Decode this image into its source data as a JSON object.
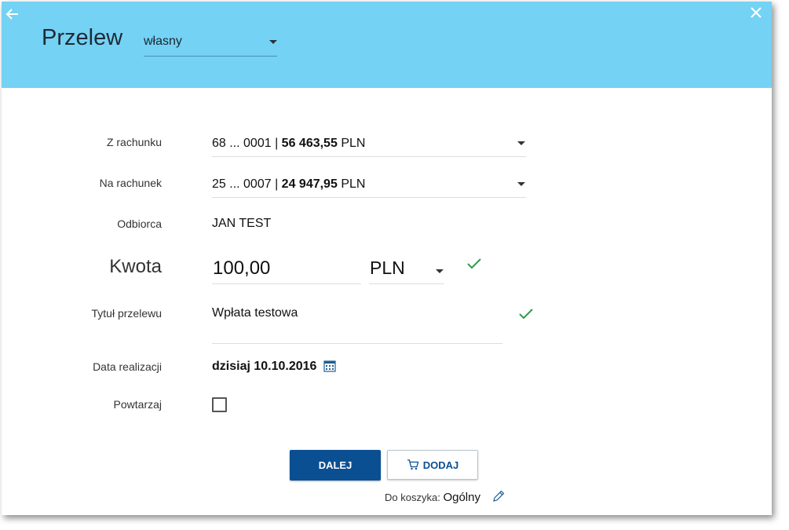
{
  "header": {
    "title": "Przelew",
    "transfer_type": "własny",
    "back_icon": "arrow-left-icon",
    "close_icon": "close-icon",
    "bg_color": "#74d2f4"
  },
  "form": {
    "from_account": {
      "label": "Z rachunku",
      "number": "68 ... 0001 |",
      "balance": "56 463,55",
      "currency": "PLN"
    },
    "to_account": {
      "label": "Na rachunek",
      "number": "25 ... 0007 |",
      "balance": "24 947,95",
      "currency": "PLN"
    },
    "recipient": {
      "label": "Odbiorca",
      "value": "JAN TEST"
    },
    "amount": {
      "label": "Kwota",
      "value": "100,00",
      "currency": "PLN"
    },
    "title": {
      "label": "Tytuł przelewu",
      "value": "Wpłata testowa"
    },
    "date": {
      "label": "Data realizacji",
      "value": "dzisiaj 10.10.2016"
    },
    "repeat": {
      "label": "Powtarzaj",
      "checked": false
    }
  },
  "actions": {
    "next_label": "DALEJ",
    "add_label": "DODAJ",
    "basket_prefix": "Do koszyka:",
    "basket_name": "Ogólny"
  },
  "colors": {
    "primary": "#0b4f93",
    "valid": "#2e9b4a"
  }
}
